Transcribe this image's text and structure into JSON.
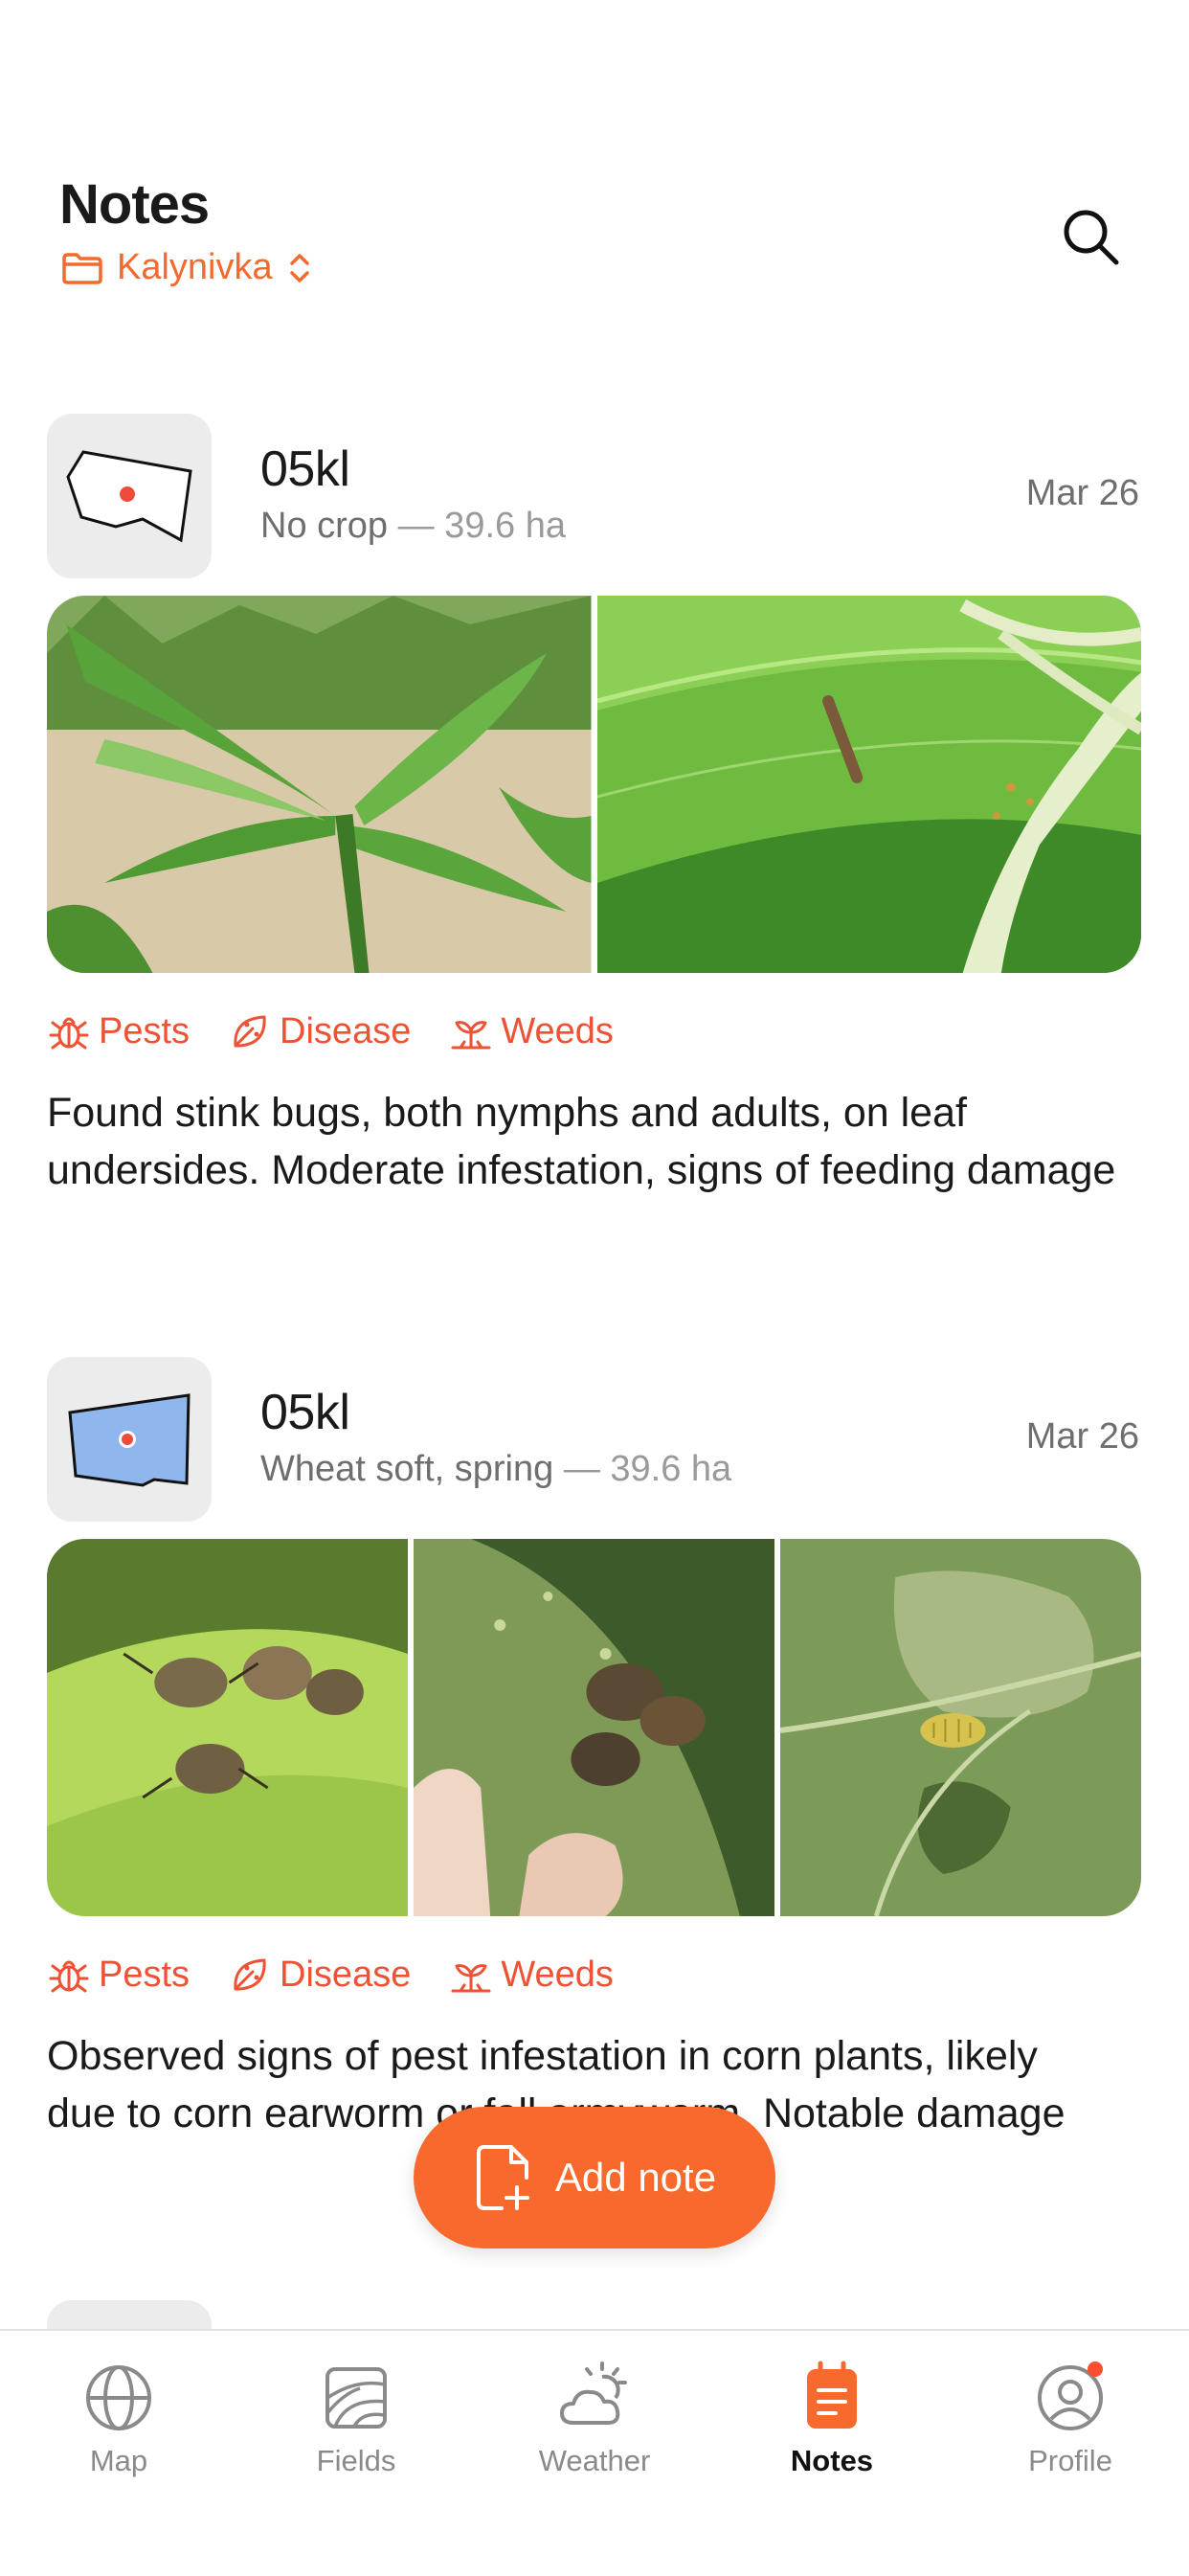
{
  "header": {
    "title": "Notes",
    "farm": "Kalynivka"
  },
  "notes": [
    {
      "field_name": "05kl",
      "crop": "No crop",
      "area": "— 39.6 ha",
      "date": "Mar 26",
      "tags": [
        "Pests",
        "Disease",
        "Weeds"
      ],
      "text_line1": "Found stink bugs, both nymphs and adults, on leaf",
      "text_line2": "undersides. Moderate infestation, signs of feeding damage"
    },
    {
      "field_name": "05kl",
      "crop": "Wheat soft, spring",
      "area": "— 39.6 ha",
      "date": "Mar 26",
      "tags": [
        "Pests",
        "Disease",
        "Weeds"
      ],
      "text_line1": "Observed signs of pest infestation in corn plants, likely",
      "text_line2": "due to corn earworm or fall armyworm. Notable damage"
    }
  ],
  "add_note_label": "Add note",
  "tabbar": {
    "items": [
      {
        "label": "Map",
        "icon": "globe-icon"
      },
      {
        "label": "Fields",
        "icon": "fields-icon"
      },
      {
        "label": "Weather",
        "icon": "weather-icon"
      },
      {
        "label": "Notes",
        "icon": "notes-icon",
        "active": true
      },
      {
        "label": "Profile",
        "icon": "profile-icon",
        "badge": true
      }
    ]
  },
  "colors": {
    "accent": "#f7692c",
    "tag": "#ee5235",
    "field_fill": "#8fb7ee"
  }
}
